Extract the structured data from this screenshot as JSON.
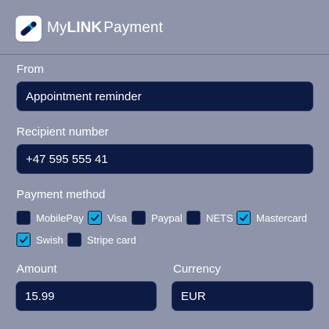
{
  "header": {
    "brand_prefix": "My",
    "brand_bold": "LINK",
    "brand_suffix": "Payment",
    "logo_icon": "link-app-logo-icon"
  },
  "form": {
    "from": {
      "label": "From",
      "value": "Appointment reminder"
    },
    "recipient": {
      "label": "Recipient number",
      "value": "+47 595 555 41"
    },
    "payment_method": {
      "label": "Payment method",
      "options": [
        {
          "label": "MobilePay",
          "checked": false
        },
        {
          "label": "Visa",
          "checked": true
        },
        {
          "label": "Paypal",
          "checked": false
        },
        {
          "label": "NETS",
          "checked": false
        },
        {
          "label": "Mastercard",
          "checked": true
        },
        {
          "label": "Swish",
          "checked": true
        },
        {
          "label": "Stripe card",
          "checked": false
        }
      ]
    },
    "amount": {
      "label": "Amount",
      "value": "15.99"
    },
    "currency": {
      "label": "Currency",
      "value": "EUR"
    }
  },
  "colors": {
    "background": "#8e95aa",
    "field_bg": "#0c1a44",
    "checkbox_checked": "#1aa8e0"
  }
}
